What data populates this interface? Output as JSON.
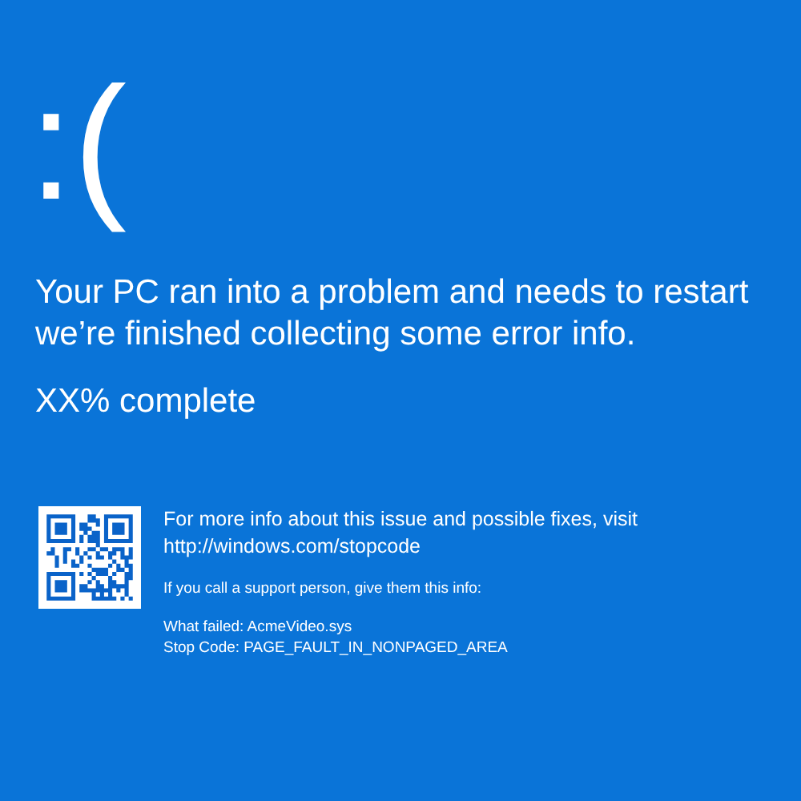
{
  "face": ":(",
  "message_lines": [
    "Your PC ran into a problem and needs to restart",
    "we’re finished collecting some error info."
  ],
  "progress": "XX% complete",
  "info_lines": [
    "For more info about this issue and possible fixes, visit",
    "http://windows.com/stopcode"
  ],
  "support_note": "If you call a support person, give them this info:",
  "details": [
    "What failed: AcmeVideo.sys",
    "Stop Code: PAGE_FAULT_IN_NONPAGED_AREA"
  ]
}
